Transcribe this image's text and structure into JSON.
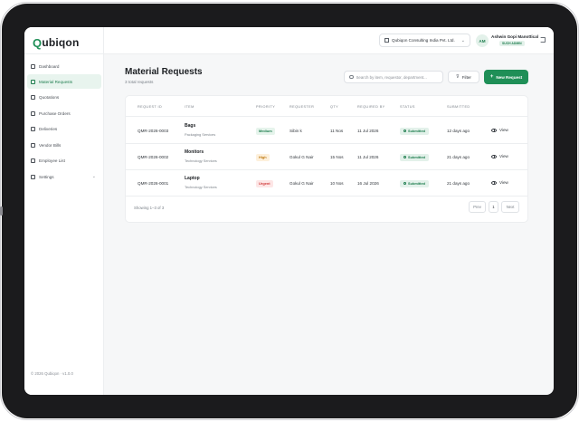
{
  "brand": {
    "logo_q": "Q",
    "logo_rest": "ubiqon"
  },
  "sidebar": {
    "items": [
      {
        "label": "Dashboard",
        "active": false
      },
      {
        "label": "Material Requests",
        "active": true
      },
      {
        "label": "Quotations",
        "active": false
      },
      {
        "label": "Purchase Orders",
        "active": false
      },
      {
        "label": "Deliveries",
        "active": false
      },
      {
        "label": "Vendor Bills",
        "active": false
      },
      {
        "label": "Employee List",
        "active": false
      },
      {
        "label": "Settings",
        "active": false,
        "expandable": true
      }
    ],
    "copyright": "© 2026 Qubiqon · v1.0.0"
  },
  "header": {
    "company": "Qubiqon Consulting India Pvt. Ltd.",
    "user_initials": "AM",
    "user_name": "Ashwin Gopi Manottical",
    "user_role": "SUCH ADMIN"
  },
  "page": {
    "title": "Material Requests",
    "subtitle": "3 total requests",
    "search_placeholder": "Search by item, requestor, department...",
    "filter_label": "Filter",
    "new_label": "New Request"
  },
  "table": {
    "columns": [
      "REQUEST ID",
      "ITEM",
      "PRIORITY",
      "REQUESTER",
      "QTY",
      "REQUIRED BY",
      "STATUS",
      "SUBMITTED",
      ""
    ],
    "rows": [
      {
        "id": "QMR-2026-0003",
        "item": "Bags",
        "category": "Packaging Services",
        "priority": "Medium",
        "requester": "Sibin k",
        "qty": "11 Nos",
        "required_by": "11 Jul 2026",
        "status": "Submitted",
        "submitted": "12 days ago",
        "action": "View"
      },
      {
        "id": "QMR-2026-0002",
        "item": "Monitors",
        "category": "Technology Services",
        "priority": "High",
        "requester": "Gokul G Nair",
        "qty": "15 Nos",
        "required_by": "11 Jul 2026",
        "status": "Submitted",
        "submitted": "21 days ago",
        "action": "View"
      },
      {
        "id": "QMR-2026-0001",
        "item": "Laptop",
        "category": "Technology Services",
        "priority": "Urgent",
        "requester": "Gokul G Nair",
        "qty": "10 Nos",
        "required_by": "16 Jul 2026",
        "status": "Submitted",
        "submitted": "21 days ago",
        "action": "View"
      }
    ],
    "showing": "Showing 1–3 of 3",
    "pagination": {
      "prev": "Prev",
      "page": "1",
      "next": "Next"
    }
  },
  "colors": {
    "accent": "#1f8f57",
    "priority_medium_bg": "#e6f4ec",
    "priority_medium_fg": "#1e7d4e",
    "priority_high_bg": "#fdf0dc",
    "priority_high_fg": "#c07a12",
    "priority_urgent_bg": "#fde6e6",
    "priority_urgent_fg": "#cf3b3b"
  }
}
